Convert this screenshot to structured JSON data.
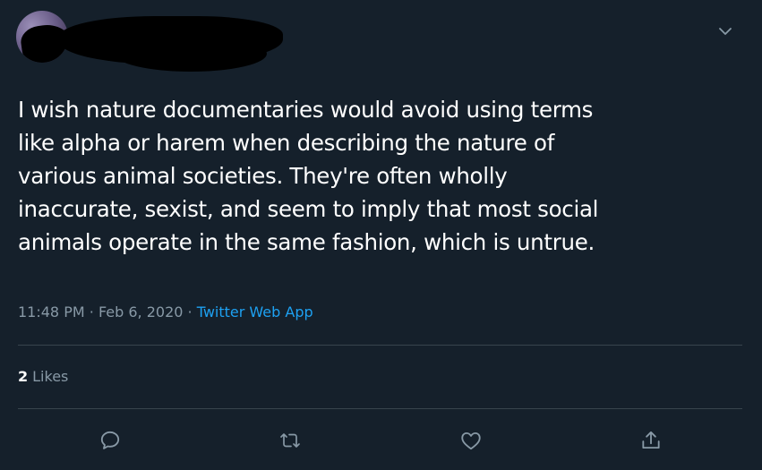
{
  "tweet": {
    "text_lines": [
      "I wish nature documentaries would avoid using terms",
      "like alpha or harem when describing the nature of",
      "various animal societies. They're often wholly",
      "inaccurate, sexist, and seem to imply that most social",
      "animals operate in the same fashion, which is untrue."
    ],
    "time": "11:48 PM",
    "separator": "·",
    "date": "Feb 6, 2020",
    "source": "Twitter Web App"
  },
  "stats": {
    "likes_count": "2",
    "likes_label": "Likes"
  },
  "icons": {
    "menu": "chevron-down-icon",
    "reply": "reply-icon",
    "retweet": "retweet-icon",
    "like": "heart-icon",
    "share": "share-icon"
  },
  "colors": {
    "background": "#15202b",
    "text": "#ffffff",
    "secondary": "#8899a6",
    "link": "#1da1f2",
    "divider": "#38444d"
  }
}
